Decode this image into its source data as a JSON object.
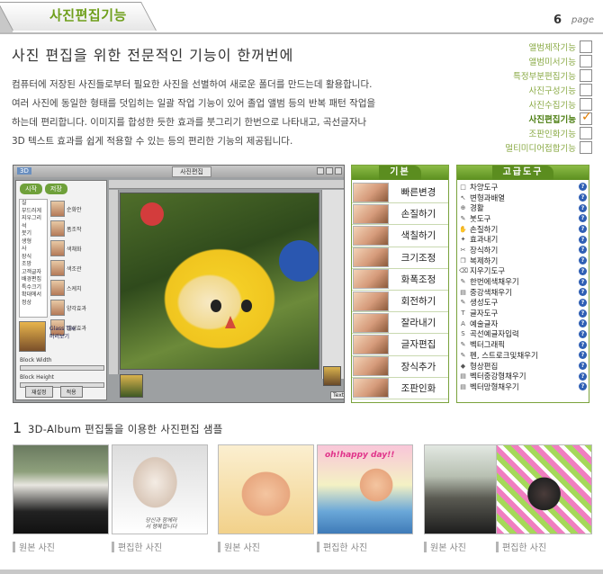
{
  "header": {
    "title": "사진편집기능",
    "page_number": "6",
    "page_word": "page"
  },
  "headline": "사진 편집을 위한 전문적인 기능이 한꺼번에",
  "intro": [
    "컴퓨터에 저장된 사진들로부터 필요한 사진을 선별하여 새로운 폴더를 만드는데 활용합니다.",
    "여러 사진에 동일한 형태를 덧입히는 일괄 작업 기능이 있어 졸업 앨범 등의 반복 패턴 작업을",
    "하는데 편리합니다. 이미지를 합성한 듯한 효과를 붓그리기 한번으로 나타내고, 곡선글자나",
    "3D 텍스트 효과를 쉽게 적용할 수 있는 등의 편리한 기능의 제공됩니다."
  ],
  "features": [
    {
      "label": "앨범제작기능",
      "checked": false
    },
    {
      "label": "앨범미서기능",
      "checked": false
    },
    {
      "label": "특정부분편집기능",
      "checked": false
    },
    {
      "label": "사진구성기능",
      "checked": false
    },
    {
      "label": "사진수집기능",
      "checked": false
    },
    {
      "label": "사진편집기능",
      "checked": true
    },
    {
      "label": "조판인화기능",
      "checked": false
    },
    {
      "label": "멀티미디어접합기능",
      "checked": false
    }
  ],
  "app": {
    "tab_label": "사진편집",
    "start_button": "시작",
    "save_button": "저장",
    "menu_items": [
      "실",
      "부드러게",
      "지우그리",
      "석",
      "붓기",
      "생형",
      "사",
      "장식",
      "조망",
      "고객글자",
      "배경편집",
      "특수크기",
      "확대에서",
      "정상"
    ],
    "thumb_labels": [
      "순화안",
      "폼조작",
      "색채화",
      "색조관",
      "스케치",
      "양각효과",
      "셀생효과"
    ],
    "file_label": "Glass Tile",
    "file_label2": "미리보기",
    "block_width_label": "Block Width",
    "block_width_value": "20",
    "block_height_label": "Block Height",
    "block_height_value": "20",
    "apply_button": "재설정",
    "cancel_button": "적용",
    "status_label": "Text"
  },
  "basic_tools": {
    "title": "기본",
    "items": [
      "빠른변경",
      "손질하기",
      "색칠하기",
      "크기조정",
      "화폭조정",
      "회전하기",
      "잘라내기",
      "글자편집",
      "장식추가",
      "조판인화"
    ]
  },
  "advanced_tools": {
    "title": "고급도구",
    "items": [
      {
        "icon": "□",
        "label": "차양도구"
      },
      {
        "icon": "↖",
        "label": "변형과배열"
      },
      {
        "icon": "⊕",
        "label": "경활"
      },
      {
        "icon": "✎",
        "label": "붓도구"
      },
      {
        "icon": "✋",
        "label": "손질하기"
      },
      {
        "icon": "✦",
        "label": "효과내기"
      },
      {
        "icon": "✂",
        "label": "장식하기"
      },
      {
        "icon": "❐",
        "label": "복제하기"
      },
      {
        "icon": "⌫",
        "label": "지우기도구"
      },
      {
        "icon": "✎",
        "label": "한번에색채우기"
      },
      {
        "icon": "▤",
        "label": "중강색채우기"
      },
      {
        "icon": "✎",
        "label": "생성도구"
      },
      {
        "icon": "T",
        "label": "글자도구"
      },
      {
        "icon": "A",
        "label": "예술글자"
      },
      {
        "icon": "S",
        "label": "곡선예글자입력"
      },
      {
        "icon": "✎",
        "label": "벡터그래픽"
      },
      {
        "icon": "✎",
        "label": "펜, 스트로크및채우기"
      },
      {
        "icon": "◆",
        "label": "형상편집"
      },
      {
        "icon": "▤",
        "label": "벡터중강형채우기"
      },
      {
        "icon": "▤",
        "label": "벡터망형채우기"
      }
    ]
  },
  "section1": {
    "number": "1",
    "title": "3D-Album 편집툴을 이용한 사진편집 샘플"
  },
  "samples": [
    {
      "caption": "원본 사진"
    },
    {
      "caption": "편집한 사진",
      "overlay": "당신과 함께라서 행복합니다"
    },
    {
      "caption": "원본 사진"
    },
    {
      "caption": "편집한 사진",
      "overlay": "oh!happy day!!"
    },
    {
      "caption": "원본 사진"
    },
    {
      "caption": "편집한 사진"
    }
  ]
}
